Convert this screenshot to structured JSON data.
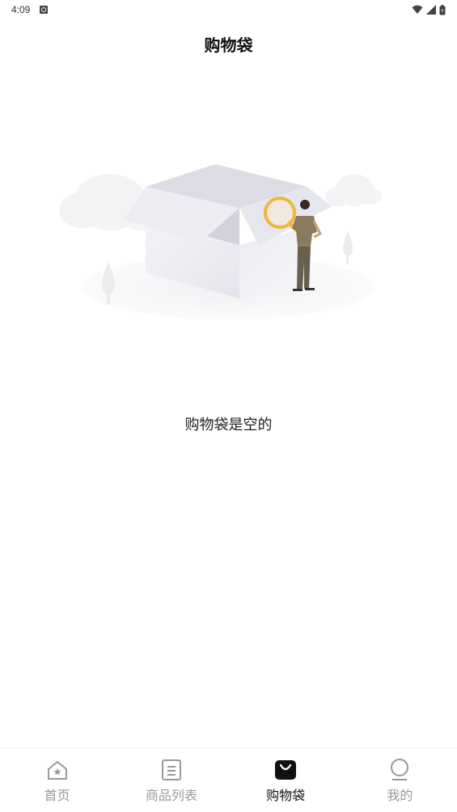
{
  "status_bar": {
    "time": "4:09",
    "icons": [
      "notification-icon",
      "wifi-icon",
      "signal-icon",
      "battery-icon"
    ]
  },
  "header": {
    "title": "购物袋"
  },
  "empty_state": {
    "illustration": "empty-box-with-person-magnifier",
    "message": "购物袋是空的"
  },
  "bottom_nav": {
    "active_index": 2,
    "items": [
      {
        "label": "首页",
        "icon": "home-icon"
      },
      {
        "label": "商品列表",
        "icon": "list-icon"
      },
      {
        "label": "购物袋",
        "icon": "bag-icon"
      },
      {
        "label": "我的",
        "icon": "profile-icon"
      }
    ]
  },
  "colors": {
    "active": "#111111",
    "inactive": "#999999",
    "accent_illustration": "#f2b43a"
  }
}
